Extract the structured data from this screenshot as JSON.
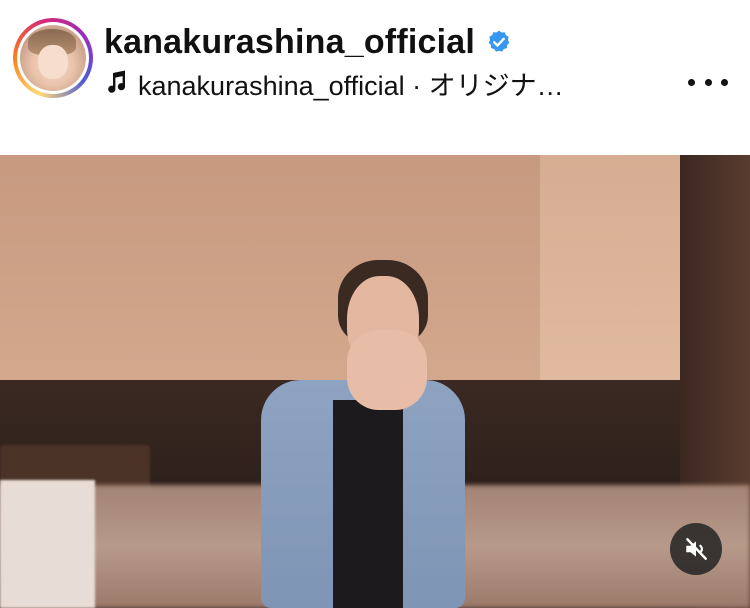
{
  "post": {
    "username": "kanakurashina_official",
    "verified": true,
    "audio": "kanakurashina_official · オリジナ…"
  },
  "icons": {
    "avatar": "avatar",
    "verified": "verified-badge-icon",
    "music": "music-note-icon",
    "more": "more-options-icon",
    "mute": "mute-icon"
  },
  "colors": {
    "verified_blue": "#3897f0",
    "text": "#111111"
  }
}
